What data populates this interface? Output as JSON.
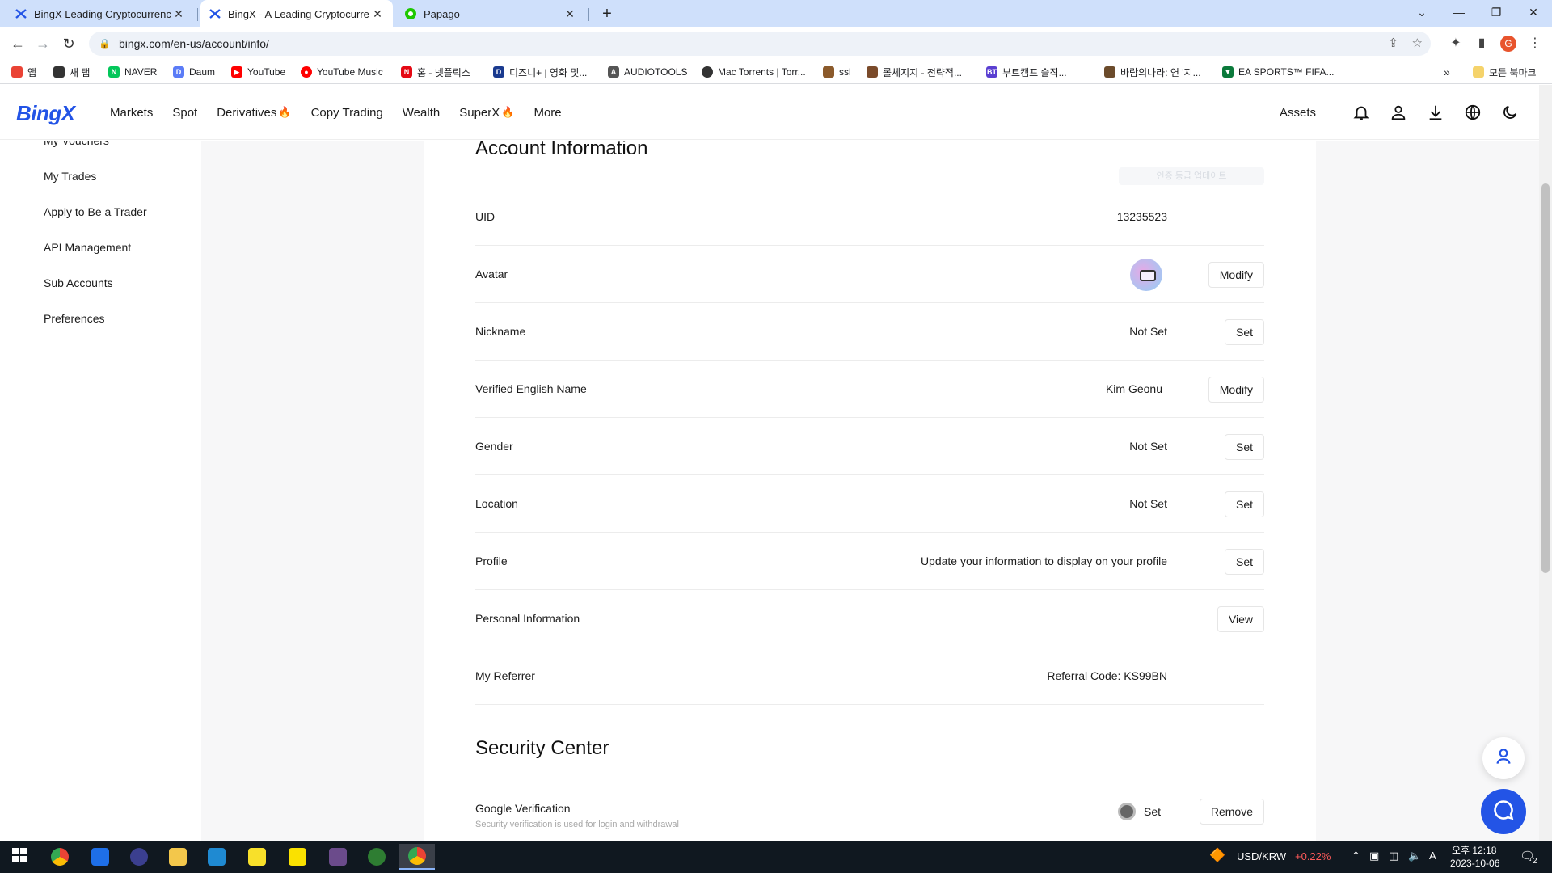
{
  "browser": {
    "tabs": [
      {
        "title": "BingX Leading Cryptocurrency",
        "close": "✕"
      },
      {
        "title": "BingX - A Leading Cryptocurre",
        "close": "✕"
      },
      {
        "title": "Papago",
        "close": "✕"
      }
    ],
    "new_tab": "+",
    "address": "bingx.com/en-us/account/info/",
    "bookmarks": [
      {
        "label": "앱",
        "color": "#ea4335"
      },
      {
        "label": "새 탭",
        "color": "#333333"
      },
      {
        "label": "NAVER",
        "color": "#03c75a"
      },
      {
        "label": "Daum",
        "color": "#5b7cf7"
      },
      {
        "label": "YouTube",
        "color": "#ff0000"
      },
      {
        "label": "YouTube Music",
        "color": "#ff0000"
      },
      {
        "label": "홈 - 넷플릭스",
        "color": "#e50914"
      },
      {
        "label": "디즈니+ | 영화 및...",
        "color": "#1a3a8f"
      },
      {
        "label": "AUDIOTOOLS",
        "color": "#555555"
      },
      {
        "label": "Mac Torrents | Torr...",
        "color": "#333333"
      },
      {
        "label": "ssl",
        "color": "#8b5a2b"
      },
      {
        "label": "롤체지지 - 전략적...",
        "color": "#7a4a2a"
      },
      {
        "label": "부트캠프 슬직...",
        "color": "#5a3fd1"
      },
      {
        "label": "바람의나라: 연 '지...",
        "color": "#6b4b2b"
      },
      {
        "label": "EA SPORTS™ FIFA...",
        "color": "#0b7a3b"
      }
    ],
    "bookmark_more": "»",
    "all_bookmarks": "모든 북마크",
    "profile_letter": "G"
  },
  "site": {
    "logo": "BingX",
    "nav": [
      {
        "label": "Markets",
        "fire": ""
      },
      {
        "label": "Spot",
        "fire": ""
      },
      {
        "label": "Derivatives",
        "fire": "🔥"
      },
      {
        "label": "Copy Trading",
        "fire": ""
      },
      {
        "label": "Wealth",
        "fire": ""
      },
      {
        "label": "SuperX",
        "fire": "🔥"
      },
      {
        "label": "More",
        "fire": ""
      }
    ],
    "assets": "Assets"
  },
  "sidebar": {
    "items": [
      "My Vouchers",
      "My Trades",
      "Apply to Be a Trader",
      "API Management",
      "Sub Accounts",
      "Preferences"
    ]
  },
  "account": {
    "title": "Account Information",
    "faint_text": "인증 등급 업데이트",
    "rows": [
      {
        "label": "UID",
        "value": "13235523",
        "button": ""
      },
      {
        "label": "Avatar",
        "value": "",
        "button": "Modify"
      },
      {
        "label": "Nickname",
        "value": "Not Set",
        "button": "Set"
      },
      {
        "label": "Verified English Name",
        "value": "Kim Geonu",
        "button": "Modify"
      },
      {
        "label": "Gender",
        "value": "Not Set",
        "button": "Set"
      },
      {
        "label": "Location",
        "value": "Not Set",
        "button": "Set"
      },
      {
        "label": "Profile",
        "value": "Update your information to display on your profile",
        "button": "Set"
      },
      {
        "label": "Personal Information",
        "value": "",
        "button": "View"
      },
      {
        "label": "My Referrer",
        "value": "Referral Code: KS99BN",
        "button": ""
      }
    ]
  },
  "security": {
    "title": "Security Center",
    "google": {
      "label": "Google Verification",
      "sub": "Security verification is used for login and withdrawal",
      "status": "Set",
      "button": "Remove"
    }
  },
  "taskbar": {
    "currency": "USD/KRW",
    "change": "+0.22%",
    "change_color": "#ff5a5a",
    "ime": "A",
    "time": "오후 12:18",
    "date": "2023-10-06",
    "notif_count": "2"
  }
}
